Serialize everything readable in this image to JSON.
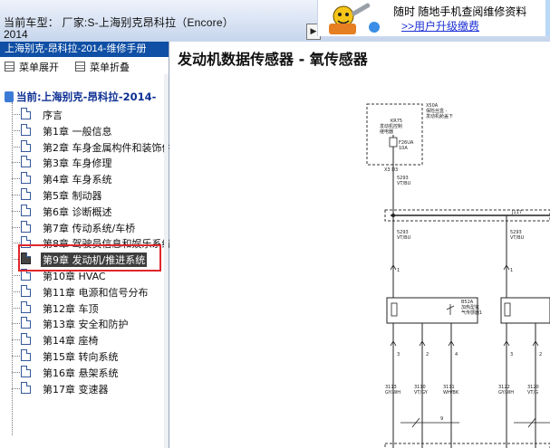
{
  "header": {
    "car_label": "当前车型：  厂家:S-上海别克昂科拉（Encore）",
    "car_year": "2014",
    "nav_arrow": "▶"
  },
  "promo": {
    "line1": "随时 随地手机查阅维修资料",
    "link": ">>用户升级缴费"
  },
  "sidebar": {
    "title": "上海别克-昂科拉-2014-维修手册",
    "expand_all": "菜单展开",
    "collapse_all": "菜单折叠",
    "root": "当前:上海别克-昂科拉-2014-",
    "items": [
      {
        "label": "序言"
      },
      {
        "label": "第1章 一般信息"
      },
      {
        "label": "第2章 车身金属构件和装饰件"
      },
      {
        "label": "第3章 车身修理"
      },
      {
        "label": "第4章 车身系统"
      },
      {
        "label": "第5章 制动器"
      },
      {
        "label": "第6章 诊断概述"
      },
      {
        "label": "第7章 传动系统/车桥"
      },
      {
        "label": "第8章 驾驶员信息和娱乐系统"
      },
      {
        "label": "第9章 发动机/推进系统"
      },
      {
        "label": "第10章 HVAC"
      },
      {
        "label": "第11章 电源和信号分布"
      },
      {
        "label": "第12章 车顶"
      },
      {
        "label": "第13章 安全和防护"
      },
      {
        "label": "第14章 座椅"
      },
      {
        "label": "第15章 转向系统"
      },
      {
        "label": "第16章 悬架系统"
      },
      {
        "label": "第17章 变速器"
      }
    ],
    "selected_index": 9,
    "highlight_color": "#e0262b",
    "title_bar_color": "#0f4fa5"
  },
  "document": {
    "title": "发动机数据传感器 - 氧传感器",
    "fuse_box": {
      "label_top": "X50A",
      "label_top_sub1": "保险丝盒 -",
      "label_top_sub2": "发动机舱盖下",
      "relay_id": "KR75",
      "relay_line1": "发动机控制",
      "relay_line2": "继电器",
      "fuse_id": "F26UA",
      "fuse_rating": "10A",
      "pins": "X3  D3"
    },
    "wires": {
      "main_circuit": "5293",
      "main_color": "VT/BU",
      "splice": "J117",
      "left_circuit": "5293",
      "left_color": "VT/BU",
      "right_circuit": "5293",
      "right_color": "VT/BU"
    },
    "sensor": {
      "id": "B52A",
      "name_line1": "加热型氧",
      "name_line2": "气传感器1"
    },
    "pins": [
      "1",
      "2",
      "3",
      "4",
      "1",
      "2"
    ],
    "bottom_pins": [
      "3",
      "4",
      "1",
      "3"
    ],
    "bottom_circuits": [
      {
        "num": "3113",
        "color": "GY/WH"
      },
      {
        "num": "3110",
        "color": "VT/GY"
      },
      {
        "num": "3111",
        "color": "WH/BK"
      },
      {
        "num": "3122",
        "color": "GY/WH"
      },
      {
        "num": "3120",
        "color": "VT/G"
      }
    ],
    "shield_number": "9"
  }
}
